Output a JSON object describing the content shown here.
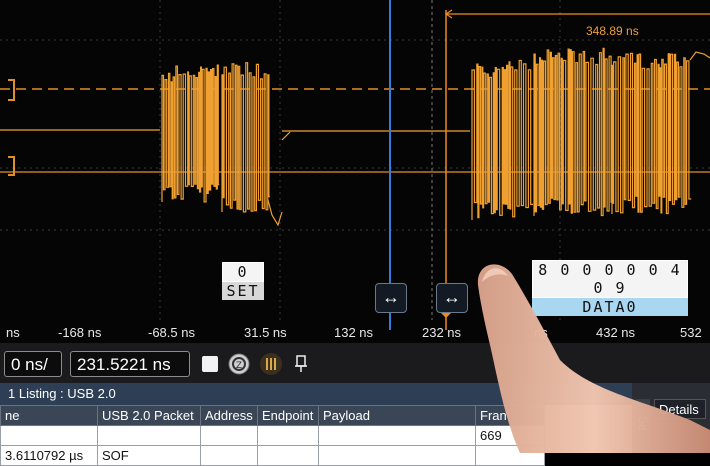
{
  "measurement": {
    "delta_label": "348.89 ns"
  },
  "decode": {
    "setup_digits": "0",
    "setup_name": "SET",
    "data_digits": "8 0 0 0 0 0 4 0 9",
    "data_name": "DATA0"
  },
  "axis": {
    "ticks": [
      "ns",
      "-168 ns",
      "-68.5 ns",
      "31.5 ns",
      "132 ns",
      "232 ns",
      "ns",
      "432 ns",
      "532"
    ]
  },
  "toolbar": {
    "timebase": "0 ns/",
    "position": "231.5221 ns"
  },
  "listing": {
    "title": "1 Listing : USB 2.0",
    "columns": [
      "ne",
      "USB 2.0 Packet",
      "Address",
      "Endpoint",
      "Payload",
      "Fran"
    ],
    "rows": [
      [
        "",
        "",
        "",
        "",
        "",
        "669"
      ],
      [
        "3.6110792 µs",
        "SOF",
        "",
        "",
        "",
        ""
      ]
    ]
  },
  "side_panel": {
    "tab1": "Se",
    "tab2": "Details"
  },
  "colors": {
    "signal": "#f0a030",
    "cursor_blue": "#3a7ad8",
    "cursor_orange": "#f08a20"
  },
  "icons": [
    "stop-square-icon",
    "zoom-icon",
    "bars-icon",
    "pin-icon",
    "double-arrow-icon"
  ]
}
